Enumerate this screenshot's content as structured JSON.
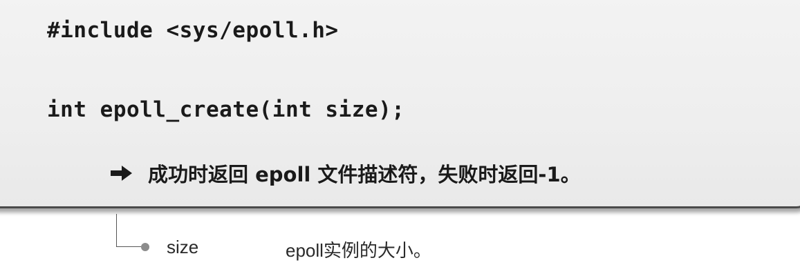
{
  "code": {
    "include_line": "#include <sys/epoll.h>",
    "prototype_line": "int epoll_create(int size);",
    "return_description": "成功时返回 epoll 文件描述符，失败时返回-1。",
    "return_icon": "arrow-right-icon"
  },
  "params": [
    {
      "name": "size",
      "description": "epoll实例的大小。",
      "bullet_icon": "bullet-dot-icon"
    }
  ],
  "colors": {
    "box_background": "#eeeeee",
    "box_border": "#4a4a4a",
    "text": "#1a1a1a",
    "bullet": "#8c8c8c"
  }
}
